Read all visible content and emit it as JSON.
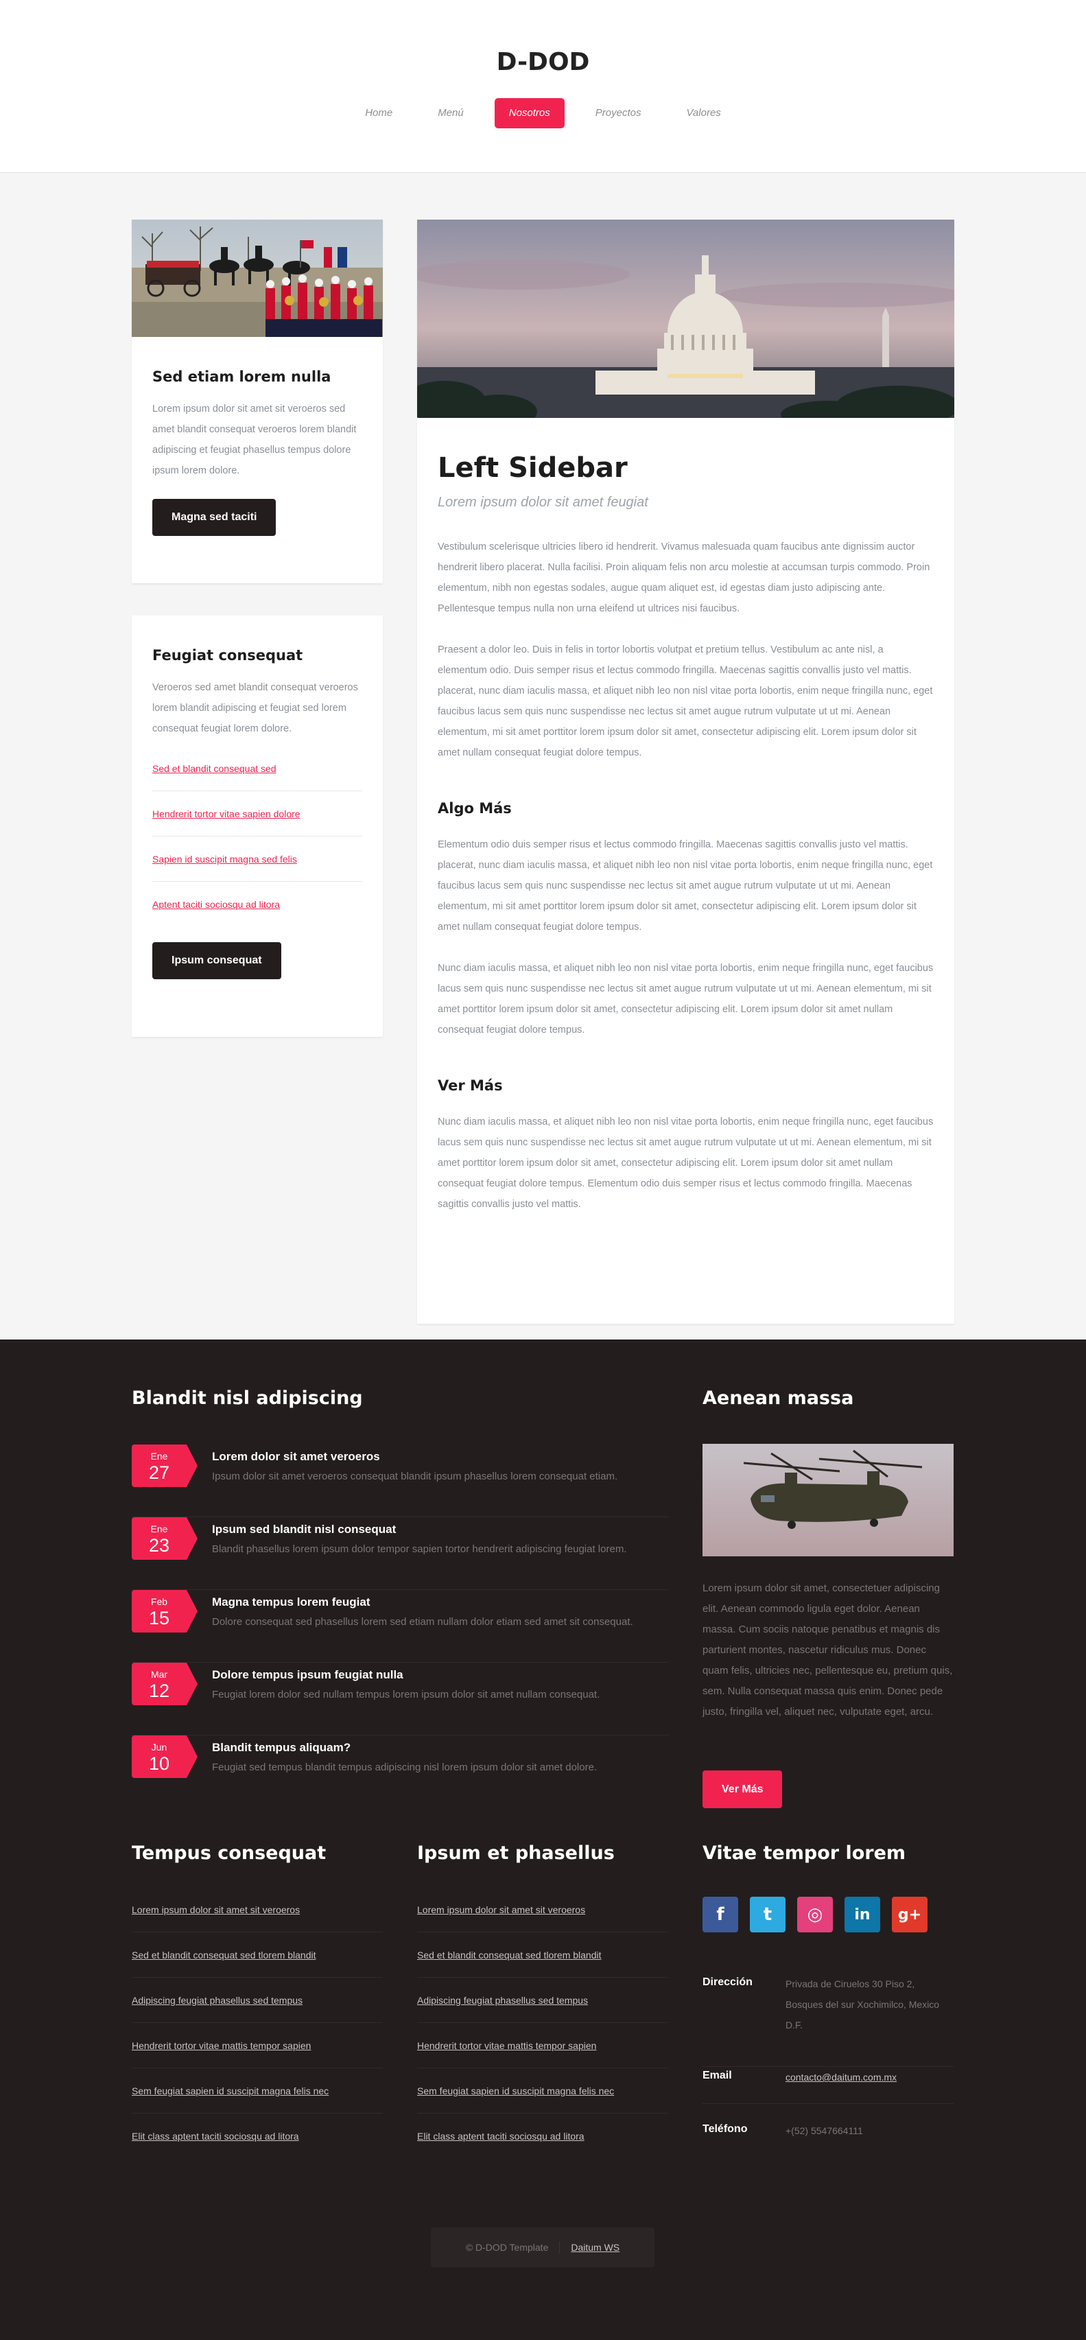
{
  "site": {
    "title": "D-DOD"
  },
  "nav": [
    {
      "label": "Home"
    },
    {
      "label": "Menú"
    },
    {
      "label": "Nosotros",
      "active": true
    },
    {
      "label": "Proyectos"
    },
    {
      "label": "Valores"
    }
  ],
  "sidebar": {
    "card1": {
      "title": "Sed etiam lorem nulla",
      "text": "Lorem ipsum dolor sit amet sit veroeros sed amet blandit consequat veroeros lorem blandit adipiscing et feugiat phasellus tempus dolore ipsum lorem dolore.",
      "button": "Magna sed taciti"
    },
    "card2": {
      "title": "Feugiat consequat",
      "text": "Veroeros sed amet blandit consequat veroeros lorem blandit adipiscing et feugiat sed lorem consequat feugiat lorem dolore.",
      "links": [
        "Sed et blandit consequat sed",
        "Hendrerit tortor vitae sapien dolore",
        "Sapien id suscipit magna sed felis",
        "Aptent taciti sociosqu ad litora"
      ],
      "button": "Ipsum consequat"
    }
  },
  "article": {
    "title": "Left Sidebar",
    "subtitle": "Lorem ipsum dolor sit amet feugiat",
    "p1": "Vestibulum scelerisque ultricies libero id hendrerit. Vivamus malesuada quam faucibus ante dignissim auctor hendrerit libero placerat. Nulla facilisi. Proin aliquam felis non arcu molestie at accumsan turpis commodo. Proin elementum, nibh non egestas sodales, augue quam aliquet est, id egestas diam justo adipiscing ante. Pellentesque tempus nulla non urna eleifend ut ultrices nisi faucibus.",
    "p2": "Praesent a dolor leo. Duis in felis in tortor lobortis volutpat et pretium tellus. Vestibulum ac ante nisl, a elementum odio. Duis semper risus et lectus commodo fringilla. Maecenas sagittis convallis justo vel mattis. placerat, nunc diam iaculis massa, et aliquet nibh leo non nisl vitae porta lobortis, enim neque fringilla nunc, eget faucibus lacus sem quis nunc suspendisse nec lectus sit amet augue rutrum vulputate ut ut mi. Aenean elementum, mi sit amet porttitor lorem ipsum dolor sit amet, consectetur adipiscing elit. Lorem ipsum dolor sit amet nullam consequat feugiat dolore tempus.",
    "h2": "Algo Más",
    "p3": "Elementum odio duis semper risus et lectus commodo fringilla. Maecenas sagittis convallis justo vel mattis. placerat, nunc diam iaculis massa, et aliquet nibh leo non nisl vitae porta lobortis, enim neque fringilla nunc, eget faucibus lacus sem quis nunc suspendisse nec lectus sit amet augue rutrum vulputate ut ut mi. Aenean elementum, mi sit amet porttitor lorem ipsum dolor sit amet, consectetur adipiscing elit. Lorem ipsum dolor sit amet nullam consequat feugiat dolore tempus.",
    "p4": "Nunc diam iaculis massa, et aliquet nibh leo non nisl vitae porta lobortis, enim neque fringilla nunc, eget faucibus lacus sem quis nunc suspendisse nec lectus sit amet augue rutrum vulputate ut ut mi. Aenean elementum, mi sit amet porttitor lorem ipsum dolor sit amet, consectetur adipiscing elit. Lorem ipsum dolor sit amet nullam consequat feugiat dolore tempus.",
    "h3": "Ver Más",
    "p5": "Nunc diam iaculis massa, et aliquet nibh leo non nisl vitae porta lobortis, enim neque fringilla nunc, eget faucibus lacus sem quis nunc suspendisse nec lectus sit amet augue rutrum vulputate ut ut mi. Aenean elementum, mi sit amet porttitor lorem ipsum dolor sit amet, consectetur adipiscing elit. Lorem ipsum dolor sit amet nullam consequat feugiat dolore tempus. Elementum odio duis semper risus et lectus commodo fringilla. Maecenas sagittis convallis justo vel mattis."
  },
  "footer": {
    "events_title": "Blandit nisl adipiscing",
    "events": [
      {
        "month": "Ene",
        "day": "27",
        "title": "Lorem dolor sit amet veroeros",
        "desc": "Ipsum dolor sit amet veroeros consequat blandit ipsum phasellus lorem consequat etiam."
      },
      {
        "month": "Ene",
        "day": "23",
        "title": "Ipsum sed blandit nisl consequat",
        "desc": "Blandit phasellus lorem ipsum dolor tempor sapien tortor hendrerit adipiscing feugiat lorem."
      },
      {
        "month": "Feb",
        "day": "15",
        "title": "Magna tempus lorem feugiat",
        "desc": "Dolore consequat sed phasellus lorem sed etiam nullam dolor etiam sed amet sit consequat."
      },
      {
        "month": "Mar",
        "day": "12",
        "title": "Dolore tempus ipsum feugiat nulla",
        "desc": "Feugiat lorem dolor sed nullam tempus lorem ipsum dolor sit amet nullam consequat."
      },
      {
        "month": "Jun",
        "day": "10",
        "title": "Blandit tempus aliquam?",
        "desc": "Feugiat sed tempus blandit tempus adipiscing nisl lorem ipsum dolor sit amet dolore."
      }
    ],
    "aside_title": "Aenean massa",
    "aside_text": "Lorem ipsum dolor sit amet, consectetuer adipiscing elit. Aenean commodo ligula eget dolor. Aenean massa. Cum sociis natoque penatibus et magnis dis parturient montes, nascetur ridiculus mus. Donec quam felis, ultricies nec, pellentesque eu, pretium quis, sem. Nulla consequat massa quis enim. Donec pede justo, fringilla vel, aliquet nec, vulputate eget, arcu.",
    "aside_button": "Ver Más",
    "col1_title": "Tempus consequat",
    "col2_title": "Ipsum et phasellus",
    "col3_title": "Vitae tempor lorem",
    "links": [
      "Lorem ipsum dolor sit amet sit veroeros",
      "Sed et blandit consequat sed tlorem blandit",
      "Adipiscing feugiat phasellus sed tempus",
      "Hendrerit tortor vitae mattis tempor sapien",
      "Sem feugiat sapien id suscipit magna felis nec",
      "Elit class aptent taciti sociosqu ad litora"
    ],
    "social": [
      {
        "icon": "facebook-icon",
        "glyph": "f",
        "color": "#3c5a99"
      },
      {
        "icon": "twitter-icon",
        "glyph": "t",
        "color": "#2daae1"
      },
      {
        "icon": "dribbble-icon",
        "glyph": "◎",
        "color": "#e4407b"
      },
      {
        "icon": "linkedin-icon",
        "glyph": "in",
        "color": "#0e76a8"
      },
      {
        "icon": "googleplus-icon",
        "glyph": "g+",
        "color": "#e13a2a"
      }
    ],
    "contact": {
      "address_label": "Dirección",
      "address": "Privada de Ciruelos 30 Piso 2, Bosques del sur Xochimilco, Mexico D.F.",
      "email_label": "Email",
      "email": "contacto@daitum.com.mx",
      "phone_label": "Teléfono",
      "phone": "+(52) 5547664111"
    },
    "copyright": "© D-DOD Template",
    "credit": "Daitum WS"
  },
  "colors": {
    "accent": "#f2224f",
    "dark": "#231d1e",
    "background": "#f5f5f5"
  }
}
